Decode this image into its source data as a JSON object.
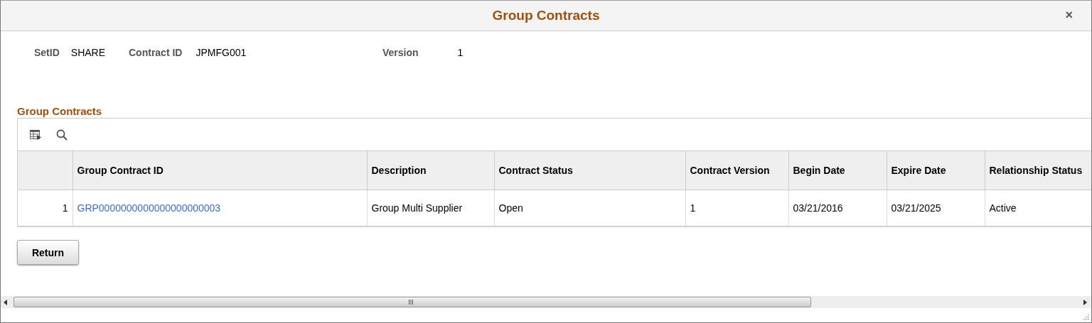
{
  "dialog": {
    "title": "Group Contracts",
    "close": "×"
  },
  "fields": [
    {
      "label": "SetID",
      "value": "SHARE"
    },
    {
      "label": "Contract ID",
      "value": "JPMFG001"
    },
    {
      "label": "Version",
      "value": "1"
    }
  ],
  "grid": {
    "title": "Group Contracts",
    "columns": [
      "",
      "Group Contract ID",
      "Description",
      "Contract Status",
      "Contract Version",
      "Begin Date",
      "Expire Date",
      "Relationship Status"
    ],
    "rows": [
      {
        "cells": [
          {
            "kind": "number",
            "text": "1"
          },
          {
            "kind": "link",
            "text": "GRP0000000000000000000003"
          },
          {
            "kind": "text",
            "text": "Group Multi Supplier"
          },
          {
            "kind": "text",
            "text": "Open"
          },
          {
            "kind": "text",
            "text": "1"
          },
          {
            "kind": "text",
            "text": "03/21/2016"
          },
          {
            "kind": "text",
            "text": "03/21/2025"
          },
          {
            "kind": "text",
            "text": "Active"
          }
        ]
      }
    ]
  },
  "buttons": [
    "Return"
  ]
}
